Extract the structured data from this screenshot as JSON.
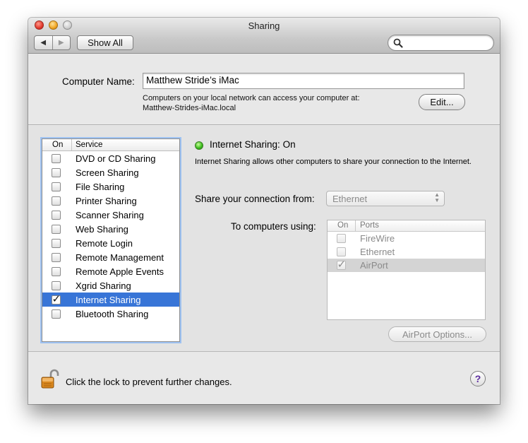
{
  "window": {
    "title": "Sharing"
  },
  "toolbar": {
    "back_icon": "back-arrow-icon",
    "forward_icon": "forward-arrow-icon",
    "show_all_label": "Show All",
    "search_value": "",
    "search_placeholder": ""
  },
  "computer_name": {
    "label": "Computer Name:",
    "value": "Matthew Stride’s iMac",
    "description_line1": "Computers on your local network can access your computer at:",
    "description_line2": "Matthew-Strides-iMac.local",
    "edit_label": "Edit..."
  },
  "services": {
    "header_on": "On",
    "header_service": "Service",
    "items": [
      {
        "name": "DVD or CD Sharing",
        "on": false,
        "selected": false
      },
      {
        "name": "Screen Sharing",
        "on": false,
        "selected": false
      },
      {
        "name": "File Sharing",
        "on": false,
        "selected": false
      },
      {
        "name": "Printer Sharing",
        "on": false,
        "selected": false
      },
      {
        "name": "Scanner Sharing",
        "on": false,
        "selected": false
      },
      {
        "name": "Web Sharing",
        "on": false,
        "selected": false
      },
      {
        "name": "Remote Login",
        "on": false,
        "selected": false
      },
      {
        "name": "Remote Management",
        "on": false,
        "selected": false
      },
      {
        "name": "Remote Apple Events",
        "on": false,
        "selected": false
      },
      {
        "name": "Xgrid Sharing",
        "on": false,
        "selected": false
      },
      {
        "name": "Internet Sharing",
        "on": true,
        "selected": true
      },
      {
        "name": "Bluetooth Sharing",
        "on": false,
        "selected": false
      }
    ]
  },
  "detail": {
    "status_title": "Internet Sharing: On",
    "status_color": "#3fbf20",
    "description": "Internet Sharing allows other computers to share your connection to the Internet.",
    "share_from_label": "Share your connection from:",
    "share_from_value": "Ethernet",
    "to_computers_label": "To computers using:",
    "ports_header_on": "On",
    "ports_header_ports": "Ports",
    "ports": [
      {
        "name": "FireWire",
        "on": false,
        "selected": false
      },
      {
        "name": "Ethernet",
        "on": false,
        "selected": false
      },
      {
        "name": "AirPort",
        "on": true,
        "selected": true
      }
    ],
    "airport_options_label": "AirPort Options..."
  },
  "footer": {
    "lock_text": "Click the lock to prevent further changes.",
    "lock_icon": "unlocked-padlock-icon",
    "help_label": "?"
  },
  "colors": {
    "selection": "#3875d7",
    "focus_ring": "#9ec2f2"
  }
}
